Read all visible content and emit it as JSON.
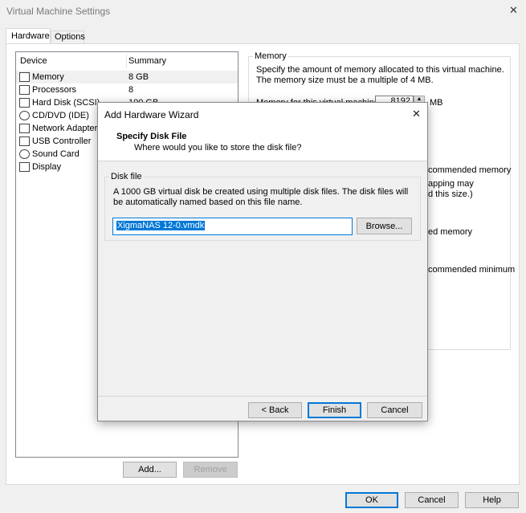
{
  "window": {
    "title": "Virtual Machine Settings",
    "close_glyph": "✕"
  },
  "tabs": [
    {
      "label": "Hardware"
    },
    {
      "label": "Options"
    }
  ],
  "device_list": {
    "columns": {
      "device": "Device",
      "summary": "Summary"
    },
    "rows": [
      {
        "device": "Memory",
        "summary": "8 GB",
        "icon": "memory-icon"
      },
      {
        "device": "Processors",
        "summary": "8",
        "icon": "processor-icon"
      },
      {
        "device": "Hard Disk (SCSI)",
        "summary": "100 GB",
        "icon": "hard-disk-icon"
      },
      {
        "device": "CD/DVD (IDE)",
        "summary": "",
        "icon": "cd-dvd-icon"
      },
      {
        "device": "Network Adapter",
        "summary": "",
        "icon": "network-adapter-icon"
      },
      {
        "device": "USB Controller",
        "summary": "",
        "icon": "usb-controller-icon"
      },
      {
        "device": "Sound Card",
        "summary": "",
        "icon": "sound-card-icon"
      },
      {
        "device": "Display",
        "summary": "",
        "icon": "display-icon"
      }
    ]
  },
  "memory_panel": {
    "group_label": "Memory",
    "description": "Specify the amount of memory allocated to this virtual machine. The memory size must be a multiple of 4 MB.",
    "field_label": "Memory for this virtual machine:",
    "value": "8192",
    "unit": "MB",
    "partial_1": "commended memory",
    "partial_2a": "apping may",
    "partial_2b": "d this size.)",
    "partial_3": "ed memory",
    "partial_4": "commended minimum"
  },
  "left_buttons": {
    "add": "Add...",
    "remove": "Remove"
  },
  "bottom_buttons": {
    "ok": "OK",
    "cancel": "Cancel",
    "help": "Help"
  },
  "wizard": {
    "title": "Add Hardware Wizard",
    "close_glyph": "✕",
    "heading": "Specify Disk File",
    "subheading": "Where would you like to store the disk file?",
    "group_label": "Disk file",
    "description": "A 1000 GB virtual disk be created using multiple disk files. The disk files will be automatically named based on this file name.",
    "filename": "XigmaNAS 12-0.vmdk",
    "browse": "Browse...",
    "back": "< Back",
    "finish": "Finish",
    "cancel": "Cancel"
  },
  "colors": {
    "selection": "#0078d7",
    "window_bg": "#f0f0f0"
  }
}
